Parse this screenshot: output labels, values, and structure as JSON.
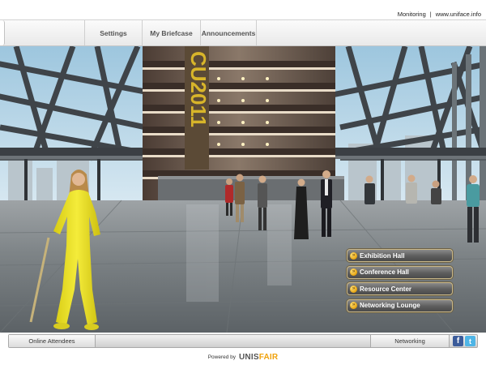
{
  "header": {
    "monitoring_link": "Monitoring",
    "separator": "|",
    "site_link": "www.uniface.info"
  },
  "nav": {
    "tabs": [
      {
        "label": "Settings"
      },
      {
        "label": "My Briefcase"
      },
      {
        "label": "Announcements"
      }
    ]
  },
  "scene": {
    "banner_text": "CU2011"
  },
  "hall_menu": [
    {
      "label": "Exhibition Hall",
      "bullet": "»"
    },
    {
      "label": "Conference Hall",
      "bullet": "»"
    },
    {
      "label": "Resource Center",
      "bullet": "»"
    },
    {
      "label": "Networking Lounge",
      "bullet": "»"
    }
  ],
  "bottom_bar": {
    "attendees_label": "Online Attendees",
    "networking_label": "Networking",
    "facebook_glyph": "f",
    "twitter_glyph": "t"
  },
  "footer": {
    "powered_by": "Powered by",
    "logo_part1": "UNIS",
    "logo_part2": "FAIR"
  },
  "colors": {
    "accent_gold": "#f0a20c",
    "facebook": "#3b5b9a",
    "twitter": "#4fb5e6",
    "hostess_suit": "#f2e82a"
  },
  "icons": [
    "info-bullet-icon",
    "facebook-icon",
    "twitter-icon"
  ]
}
